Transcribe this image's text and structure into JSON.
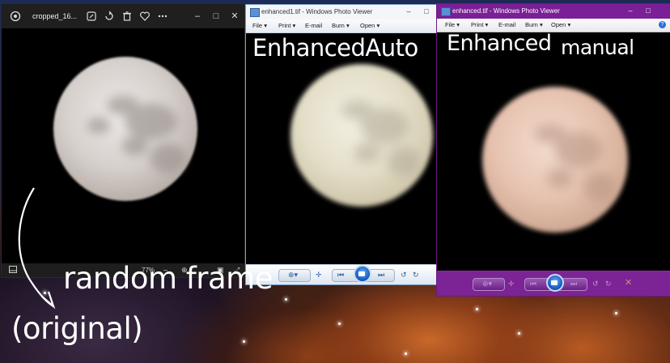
{
  "photos_app": {
    "filename": "cropped_16...",
    "zoom": "77%",
    "icons": [
      "app-icon",
      "edit-icon",
      "rotate-icon",
      "delete-icon",
      "favorite-icon",
      "more-icon"
    ],
    "window_controls": [
      "–",
      "□",
      "✕"
    ]
  },
  "viewer_auto": {
    "title": "enhanced1.tif - Windows Photo Viewer",
    "menu": {
      "file": "File",
      "print": "Print",
      "email": "E-mail",
      "burn": "Burn",
      "open": "Open"
    }
  },
  "viewer_manual": {
    "title": "enhanced.tif - Windows Photo Viewer",
    "menu": {
      "file": "File",
      "print": "Print",
      "email": "E-mail",
      "burn": "Burn",
      "open": "Open"
    }
  },
  "annotations": {
    "auto": "EnhancedAuto",
    "manual_1": "Enhanced",
    "manual_2": "manual",
    "random_frame": "random frame",
    "original": "(original)"
  },
  "colors": {
    "manual_window_accent": "#7a1f96",
    "moon_original": "#dcd6d2",
    "moon_auto": "#e6e2cc",
    "moon_manual": "#e7c6b3"
  }
}
